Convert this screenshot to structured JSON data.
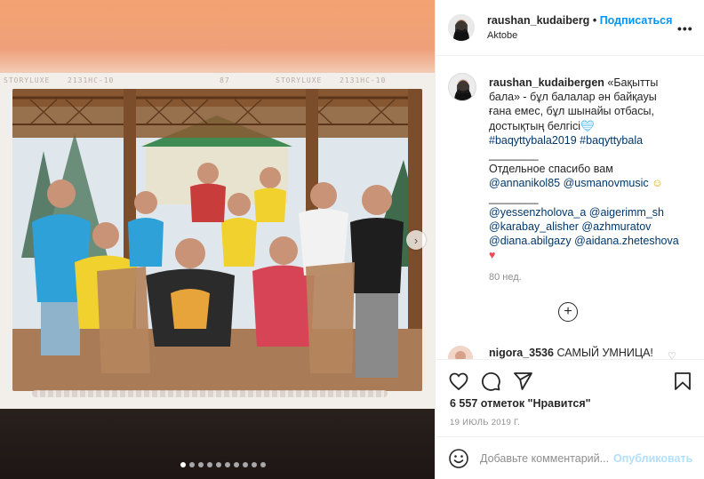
{
  "post": {
    "media": {
      "film_labels": [
        "STORYLUXE",
        "2131НС-10",
        "87",
        "STORYLUXE",
        "2131НС-10"
      ],
      "carousel_count": 10,
      "carousel_active": 1,
      "next_icon": "chevron-right-icon"
    },
    "header": {
      "username": "raushan_kudaiberg",
      "separator": "•",
      "follow_label": "Подписаться",
      "location": "Aktobe",
      "more_icon": "more-horizontal-icon"
    },
    "caption": {
      "username": "raushan_kudaibergen",
      "lines": [
        "«Бақытты",
        "бала» - бұл балалар ән байқауы",
        "ғана емес, бұл шынайы отбасы,",
        "достықтың белгісі"
      ],
      "hashtags": "#baqyttybala2019 #baqyttybala",
      "divider1": "________",
      "thanks": "Отдельное спасибо вам",
      "mentions1": "@annanikol85 @usmanovmusic",
      "divider2": "________",
      "mentions2": [
        "@yessenzholova_a @aigerimm_sh",
        "@karabay_alisher @azhmuratov",
        "@diana.abilgazy @aidana.zheteshova"
      ],
      "time": "80 нед."
    },
    "comment": {
      "username": "nigora_3536",
      "text": "САМЫЙ УМНИЦА!"
    },
    "load_more_label": "+",
    "likes_text": "6 557 отметок \"Нравится\"",
    "date": "19 ИЮЛЬ 2019 Г.",
    "add_comment": {
      "placeholder": "Добавьте комментарий...",
      "publish_label": "Опубликовать"
    },
    "colors": {
      "link": "#00376b",
      "follow": "#0095f6",
      "muted": "#8e8e8e",
      "heart": "#ed4956",
      "publish_disabled": "#b2dffc"
    }
  }
}
